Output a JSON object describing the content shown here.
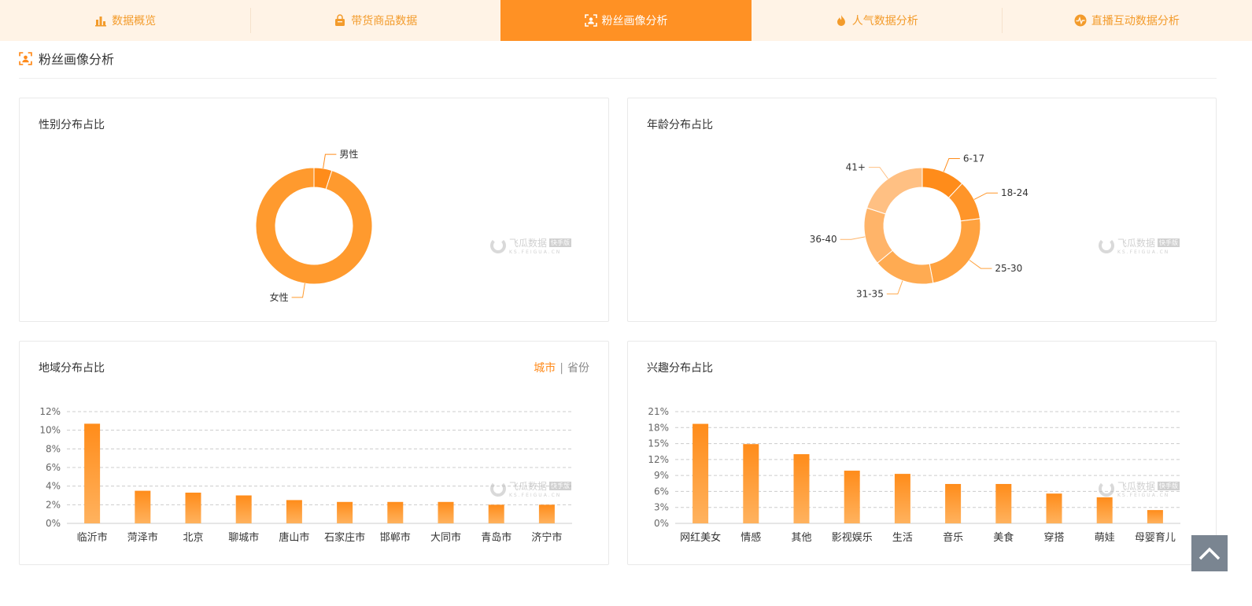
{
  "tabs": [
    {
      "label": "数据概览",
      "icon": "bar-chart-icon",
      "active": false
    },
    {
      "label": "带货商品数据",
      "icon": "shopping-basket-icon",
      "active": false
    },
    {
      "label": "粉丝画像分析",
      "icon": "user-frame-icon",
      "active": true
    },
    {
      "label": "人气数据分析",
      "icon": "flame-icon",
      "active": false
    },
    {
      "label": "直播互动数据分析",
      "icon": "pulse-icon",
      "active": false
    }
  ],
  "section": {
    "title": "粉丝画像分析",
    "icon": "user-frame-icon"
  },
  "gender": {
    "title": "性别分布占比"
  },
  "age": {
    "title": "年龄分布占比"
  },
  "region": {
    "title": "地域分布占比",
    "filter": {
      "city": "城市",
      "sep": "|",
      "province": "省份"
    }
  },
  "interest": {
    "title": "兴趣分布占比"
  },
  "watermark": {
    "name": "飞瓜数据",
    "badge": "快手版",
    "domain": "KS.FEIGUA.CN"
  },
  "colors": {
    "accent": "#ff9124",
    "tab_bg": "#fff3e6",
    "text_orange": "#f39b2b"
  },
  "chart_data": [
    {
      "type": "pie",
      "title": "性别分布占比",
      "donut": true,
      "categories": [
        "男性",
        "女性"
      ],
      "values": [
        5,
        95
      ],
      "colors": [
        "#ff8c1a",
        "#ff9a2e"
      ]
    },
    {
      "type": "pie",
      "title": "年龄分布占比",
      "donut": true,
      "categories": [
        "6-17",
        "18-24",
        "25-30",
        "31-35",
        "36-40",
        "41+"
      ],
      "values": [
        12,
        11,
        24,
        17,
        16,
        20
      ],
      "colors": [
        "#ff8c1a",
        "#ff9529",
        "#ffa23f",
        "#ffab52",
        "#ffb469",
        "#ffc083"
      ]
    },
    {
      "type": "bar",
      "title": "地域分布占比",
      "categories": [
        "临沂市",
        "菏泽市",
        "北京",
        "聊城市",
        "唐山市",
        "石家庄市",
        "邯郸市",
        "大同市",
        "青岛市",
        "济宁市"
      ],
      "values": [
        10.7,
        3.5,
        3.3,
        3.0,
        2.5,
        2.3,
        2.3,
        2.3,
        2.0,
        2.0
      ],
      "yticks": [
        "0%",
        "2%",
        "4%",
        "6%",
        "8%",
        "10%",
        "12%"
      ],
      "ylim": [
        0,
        12
      ],
      "grid": true
    },
    {
      "type": "bar",
      "title": "兴趣分布占比",
      "categories": [
        "网红美女",
        "情感",
        "其他",
        "影视娱乐",
        "生活",
        "音乐",
        "美食",
        "穿搭",
        "萌娃",
        "母婴育儿"
      ],
      "values": [
        18.7,
        14.9,
        13.0,
        9.9,
        9.3,
        7.4,
        7.4,
        5.6,
        4.9,
        2.5
      ],
      "yticks": [
        "0%",
        "3%",
        "6%",
        "9%",
        "12%",
        "15%",
        "18%",
        "21%"
      ],
      "ylim": [
        0,
        21
      ],
      "grid": true
    }
  ]
}
